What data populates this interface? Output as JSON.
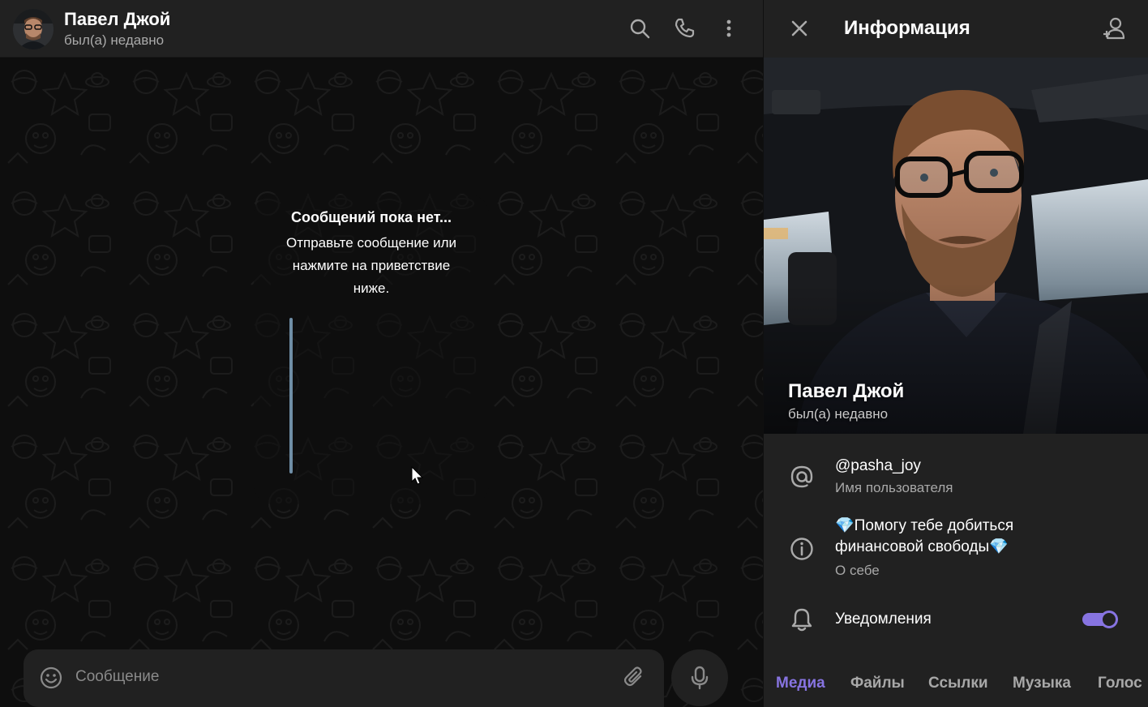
{
  "chat_header": {
    "name": "Павел Джой",
    "status": "был(а) недавно",
    "icons": [
      "search-icon",
      "phone-icon",
      "more-vertical-icon"
    ]
  },
  "empty_state": {
    "title": "Сообщений пока нет...",
    "text": "Отправьте сообщение или нажмите на приветствие ниже."
  },
  "composer": {
    "placeholder": "Сообщение",
    "icons": [
      "smile-icon",
      "attach-icon",
      "microphone-icon"
    ]
  },
  "info_panel": {
    "title": "Информация",
    "photo_name": "Павел Джой",
    "photo_status": "был(а) недавно",
    "username": {
      "value": "@pasha_joy",
      "label": "Имя пользователя"
    },
    "bio": {
      "line1": "💎Помогу тебе добиться",
      "line2": "финансовой свободы💎",
      "label": "О себе"
    },
    "notifications": {
      "label": "Уведомления",
      "enabled": true
    },
    "tabs": [
      {
        "label": "Медиа",
        "active": true
      },
      {
        "label": "Файлы",
        "active": false
      },
      {
        "label": "Ссылки",
        "active": false
      },
      {
        "label": "Музыка",
        "active": false
      },
      {
        "label": "Голос",
        "active": false
      }
    ]
  },
  "colors": {
    "accent": "#8774e1",
    "panel": "#212121",
    "background": "#0e0e0e",
    "secondary_text": "#aaaaaa"
  }
}
